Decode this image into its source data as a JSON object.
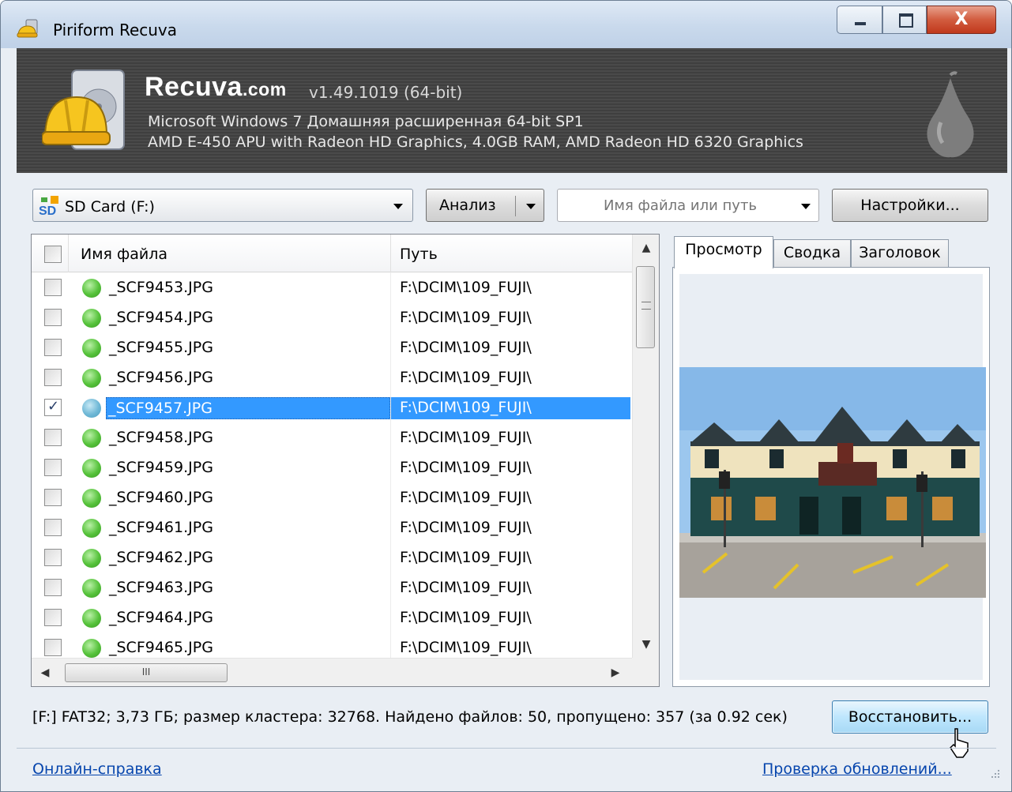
{
  "window": {
    "title": "Piriform Recuva"
  },
  "banner": {
    "brand": "Recuva",
    "brand_domain": ".com",
    "version": "v1.49.1019 (64-bit)",
    "os_line": "Microsoft Windows 7 Домашняя расширенная 64-bit SP1",
    "hw_line": "AMD E-450 APU with Radeon HD Graphics, 4.0GB RAM, AMD Radeon HD 6320 Graphics"
  },
  "toolbar": {
    "drive": "SD Card (F:)",
    "analyze_label": "Анализ",
    "path_placeholder": "Имя файла или путь",
    "settings_label": "Настройки..."
  },
  "file_list": {
    "columns": {
      "name": "Имя файла",
      "path": "Путь"
    },
    "rows": [
      {
        "name": "_SCF9453.JPG",
        "path": "F:\\DCIM\\109_FUJI\\",
        "checked": false
      },
      {
        "name": "_SCF9454.JPG",
        "path": "F:\\DCIM\\109_FUJI\\",
        "checked": false
      },
      {
        "name": "_SCF9455.JPG",
        "path": "F:\\DCIM\\109_FUJI\\",
        "checked": false
      },
      {
        "name": "_SCF9456.JPG",
        "path": "F:\\DCIM\\109_FUJI\\",
        "checked": false
      },
      {
        "name": "_SCF9457.JPG",
        "path": "F:\\DCIM\\109_FUJI\\",
        "checked": true
      },
      {
        "name": "_SCF9458.JPG",
        "path": "F:\\DCIM\\109_FUJI\\",
        "checked": false
      },
      {
        "name": "_SCF9459.JPG",
        "path": "F:\\DCIM\\109_FUJI\\",
        "checked": false
      },
      {
        "name": "_SCF9460.JPG",
        "path": "F:\\DCIM\\109_FUJI\\",
        "checked": false
      },
      {
        "name": "_SCF9461.JPG",
        "path": "F:\\DCIM\\109_FUJI\\",
        "checked": false
      },
      {
        "name": "_SCF9462.JPG",
        "path": "F:\\DCIM\\109_FUJI\\",
        "checked": false
      },
      {
        "name": "_SCF9463.JPG",
        "path": "F:\\DCIM\\109_FUJI\\",
        "checked": false
      },
      {
        "name": "_SCF9464.JPG",
        "path": "F:\\DCIM\\109_FUJI\\",
        "checked": false
      },
      {
        "name": "_SCF9465.JPG",
        "path": "F:\\DCIM\\109_FUJI\\",
        "checked": false
      }
    ],
    "selected_index": 4,
    "hscroll_thumb_label": "III"
  },
  "preview": {
    "tabs": [
      "Просмотр",
      "Сводка",
      "Заголовок"
    ],
    "active_tab": 0
  },
  "status": {
    "text": "[F:] FAT32; 3,73 ГБ; размер кластера: 32768. Найдено файлов: 50, пропущено: 357 (за 0.92 сек)",
    "restore_label": "Восстановить..."
  },
  "footer": {
    "help_link": "Онлайн-справка",
    "update_link": "Проверка обновлений..."
  },
  "colors": {
    "selection": "#3399ff",
    "banner": "#444444",
    "status_ok_dot": "#55c23a",
    "link": "#0645ad"
  }
}
